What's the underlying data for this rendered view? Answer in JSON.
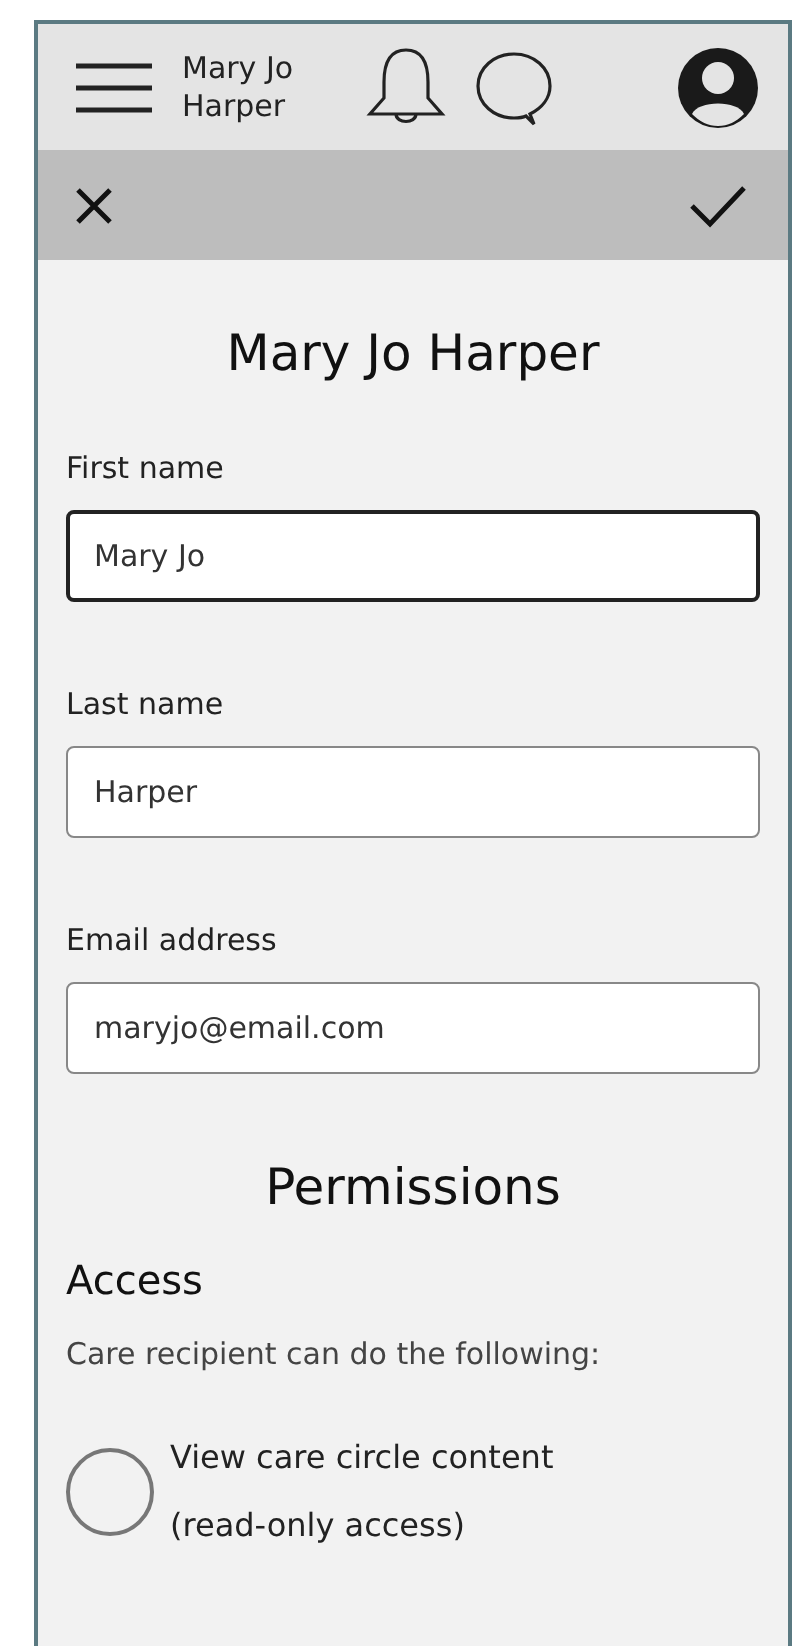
{
  "header": {
    "user_name": "Mary Jo Harper"
  },
  "title": "Mary Jo Harper",
  "fields": [
    {
      "label": "First name",
      "value": "Mary Jo",
      "focused": true
    },
    {
      "label": "Last name",
      "value": "Harper",
      "focused": false
    },
    {
      "label": "Email address",
      "value": "maryjo@email.com",
      "focused": false
    }
  ],
  "permissions": {
    "title": "Permissions",
    "section": "Access",
    "description": "Care recipient can do the following:",
    "options": [
      {
        "label": "View care circle content (read-only access)",
        "selected": false
      }
    ]
  }
}
